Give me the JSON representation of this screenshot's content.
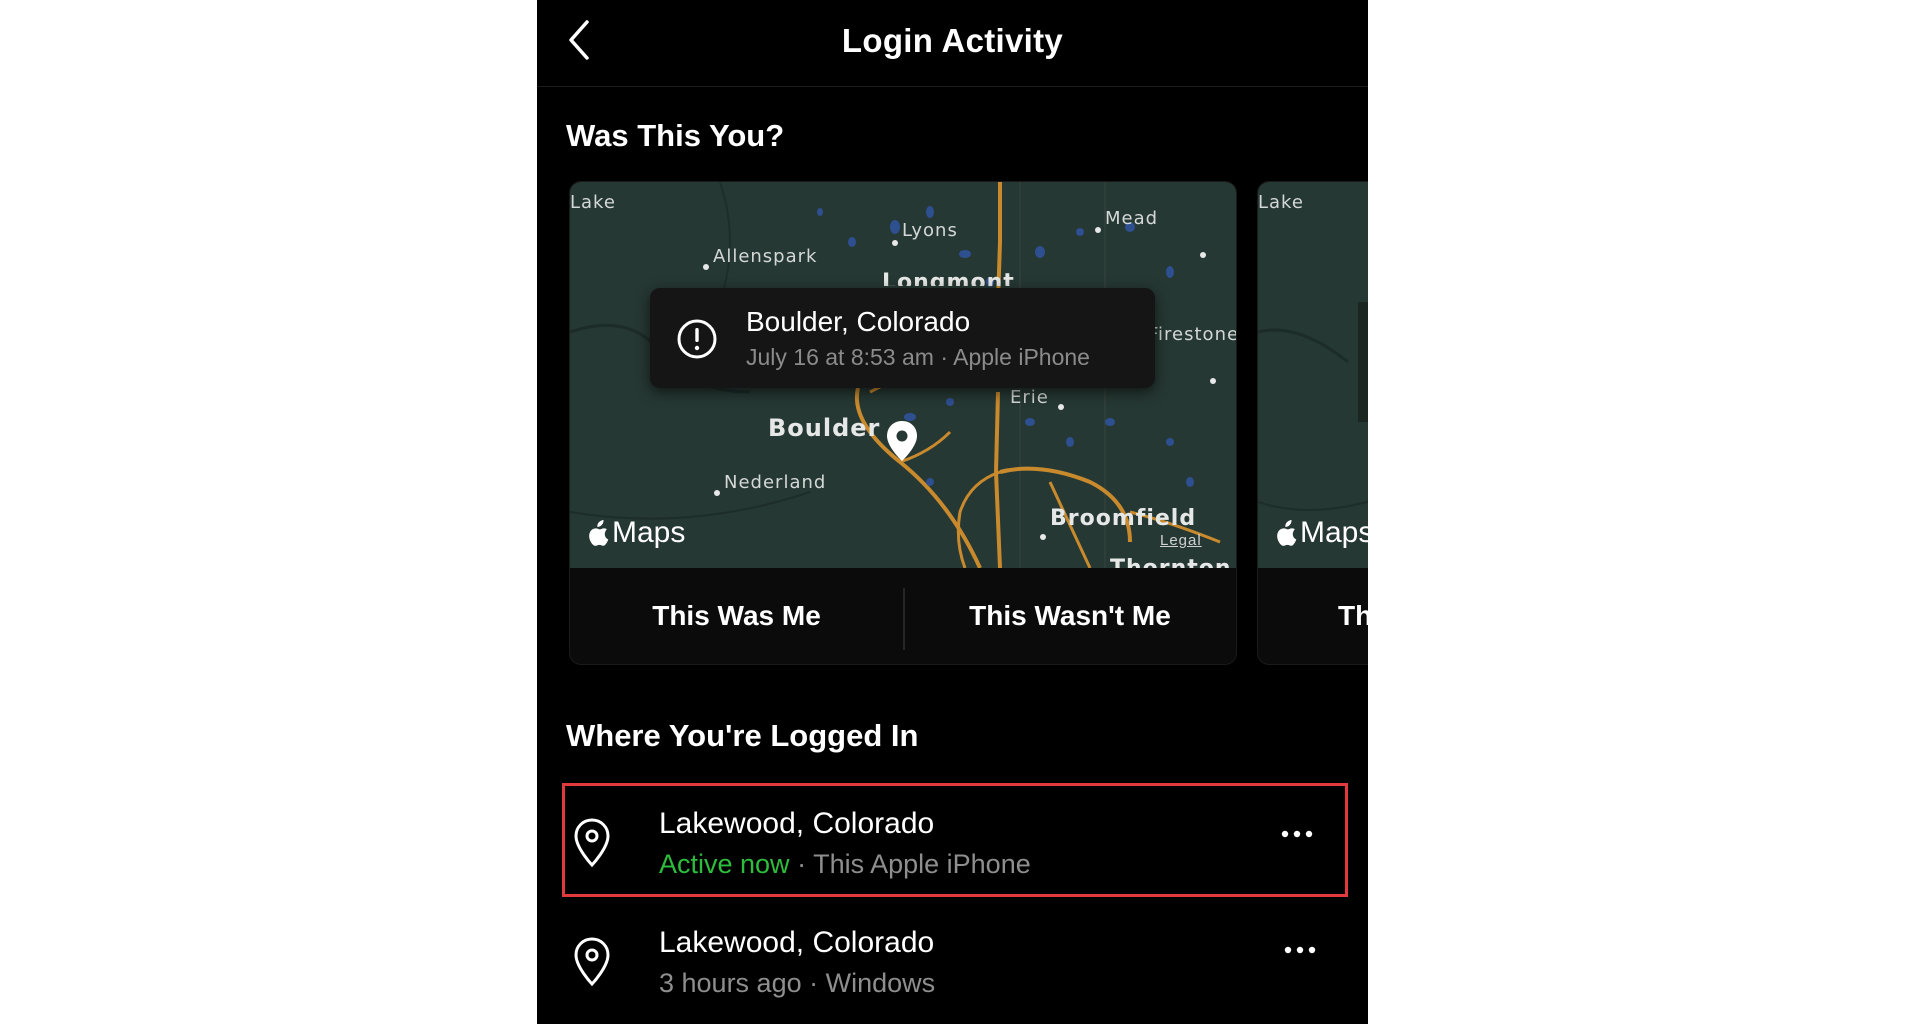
{
  "header": {
    "title": "Login Activity"
  },
  "was_this_you": {
    "title": "Was This You?",
    "cards": [
      {
        "popup": {
          "location": "Boulder, Colorado",
          "details": "July 16 at 8:53 am · Apple iPhone"
        },
        "map_labels": [
          "Lake",
          "Lyons",
          "Mead",
          "Allenspark",
          "Longmont",
          "Firestone",
          "Erie",
          "Boulder",
          "Nederland",
          "Broomfield",
          "Thornton",
          "Maps",
          "Legal"
        ],
        "buttons": {
          "confirm": "This Was Me",
          "deny": "This Wasn't Me"
        }
      },
      {
        "map_labels": [
          "Lake",
          "Maps"
        ],
        "buttons": {
          "confirm": "Th"
        }
      }
    ]
  },
  "where_logged_in": {
    "title": "Where You're Logged In",
    "sessions": [
      {
        "location": "Lakewood, Colorado",
        "status": "Active now",
        "separator": " · ",
        "device": "This Apple iPhone",
        "status_color": "#2dbd3c",
        "highlighted": true
      },
      {
        "location": "Lakewood, Colorado",
        "status": "3 hours ago",
        "separator": " · ",
        "device": "Windows",
        "highlighted": false
      }
    ]
  },
  "colors": {
    "background": "#000000",
    "highlight_border": "#e0393e",
    "active": "#2dbd3c",
    "map_bg": "#263833",
    "road": "#c98a2e"
  },
  "icons": [
    "back-chevron-icon",
    "alert-circle-icon",
    "map-pin-icon",
    "apple-logo-icon",
    "location-pin-icon",
    "more-dots-icon"
  ]
}
